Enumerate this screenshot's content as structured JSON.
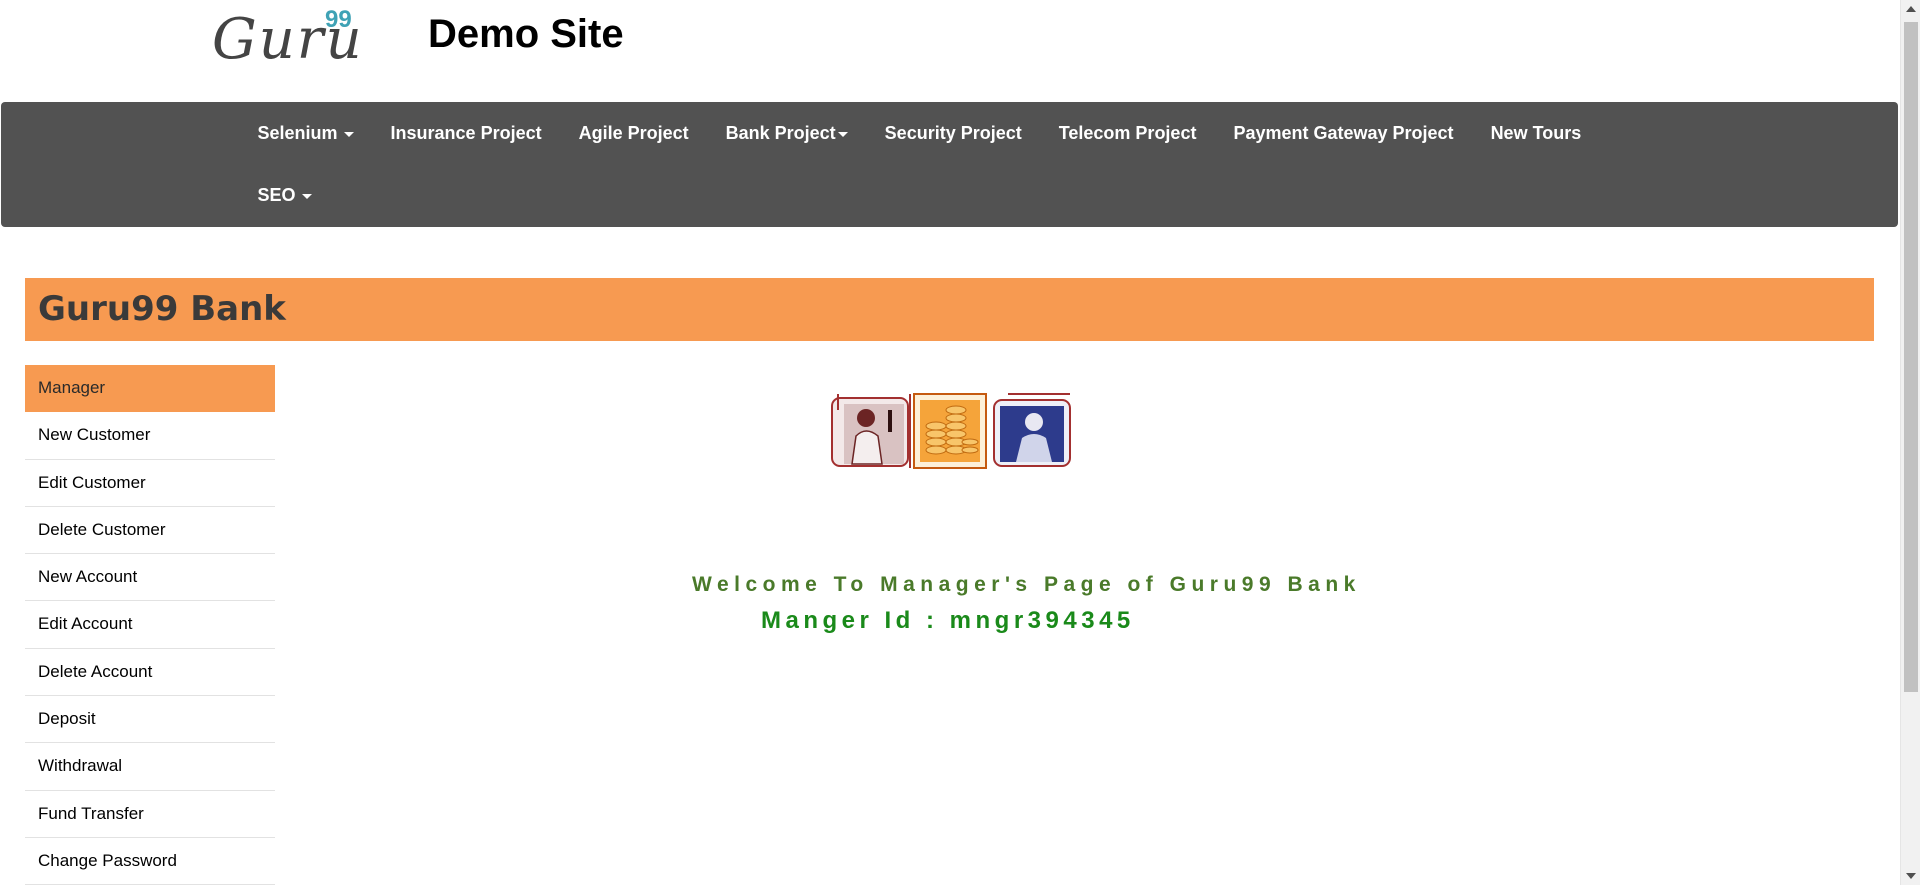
{
  "header": {
    "logo_text": "Guru",
    "logo_superscript": "99",
    "site_title": "Demo Site"
  },
  "nav": {
    "row1": [
      {
        "label": "Selenium",
        "has_caret": true
      },
      {
        "label": "Insurance Project"
      },
      {
        "label": "Agile Project"
      },
      {
        "label": "Bank Project",
        "has_caret": true
      },
      {
        "label": "Security Project"
      },
      {
        "label": "Telecom Project"
      },
      {
        "label": "Payment Gateway Project"
      },
      {
        "label": "New Tours"
      }
    ],
    "row2": [
      {
        "label": "SEO",
        "has_caret": true
      }
    ]
  },
  "bank": {
    "title": "Guru99 Bank"
  },
  "sidebar": {
    "items": [
      {
        "label": "Manager",
        "active": true
      },
      {
        "label": "New Customer"
      },
      {
        "label": "Edit Customer"
      },
      {
        "label": "Delete Customer"
      },
      {
        "label": "New Account"
      },
      {
        "label": "Edit Account"
      },
      {
        "label": "Delete Account"
      },
      {
        "label": "Deposit"
      },
      {
        "label": "Withdrawal"
      },
      {
        "label": "Fund Transfer"
      },
      {
        "label": "Change Password"
      }
    ]
  },
  "main": {
    "welcome_text": "Welcome To Manager's Page of Guru99 Bank",
    "manager_id_text": "Manger Id : mngr394345"
  },
  "colors": {
    "nav_bg": "#525252",
    "accent_orange": "#f79a51",
    "welcome_green": "#4a7a2a",
    "manager_green": "#1a8a1a"
  },
  "icons": {
    "caret": "caret-down-icon",
    "scroll_up": "scroll-up-arrow-icon",
    "scroll_down": "scroll-down-arrow-icon"
  }
}
